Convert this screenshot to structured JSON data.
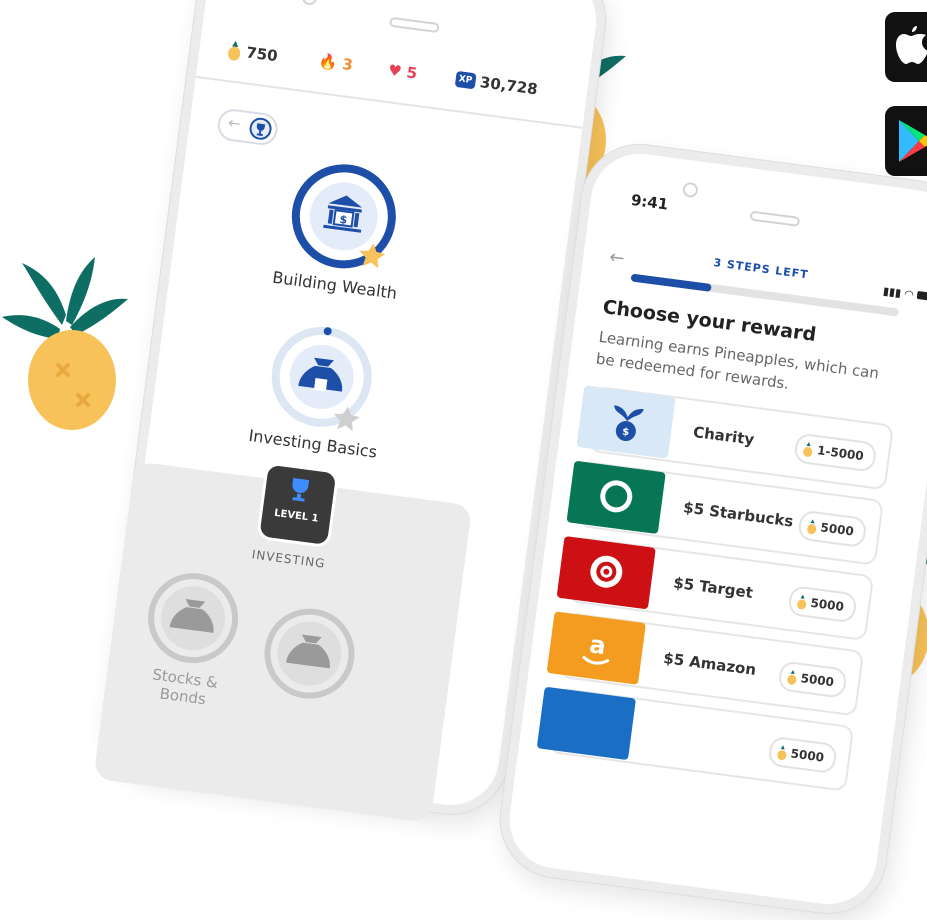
{
  "colors": {
    "brand_blue": "#1e4fa8",
    "pineapple_yellow": "#f7c25a",
    "leaf_green": "#0f6e63",
    "streak_orange": "#f08a2c",
    "heart_red": "#e84057",
    "starbucks_green": "#067655",
    "target_red": "#cc1014",
    "amazon_orange": "#f39c1f",
    "charity_blue": "#d8e8f7"
  },
  "app_phone": {
    "stats": {
      "pineapples": "750",
      "streak": "3",
      "hearts": "5",
      "xp_badge": "XP",
      "xp": "30,728"
    },
    "lessons": [
      {
        "label": "Building Wealth",
        "icon": "bank-icon",
        "status": "completed"
      },
      {
        "label": "Investing Basics",
        "icon": "money-bag-icon",
        "status": "in-progress"
      }
    ],
    "level_badge": "LEVEL 1",
    "section_title": "INVESTING",
    "locked_lessons": [
      {
        "label": "Stocks & Bonds",
        "icon": "money-bag-icon"
      },
      {
        "label": "",
        "icon": "money-bag-icon"
      }
    ]
  },
  "reward_phone": {
    "status_time": "9:41",
    "steps_left": "3 STEPS LEFT",
    "progress_fraction": 0.3,
    "title": "Choose your reward",
    "subtitle": "Learning earns Pineapples, which can be redeemed for rewards.",
    "rewards": [
      {
        "name": "Charity",
        "price": "1-5000",
        "logo": "charity-icon"
      },
      {
        "name": "$5 Starbucks",
        "price": "5000",
        "logo": "starbucks-logo"
      },
      {
        "name": "$5 Target",
        "price": "5000",
        "logo": "target-logo"
      },
      {
        "name": "$5 Amazon",
        "price": "5000",
        "logo": "amazon-logo"
      },
      {
        "name": "",
        "price": "",
        "logo": "blue-logo"
      }
    ]
  },
  "store_badges": [
    {
      "icon": "apple-icon"
    },
    {
      "icon": "google-play-icon"
    }
  ]
}
